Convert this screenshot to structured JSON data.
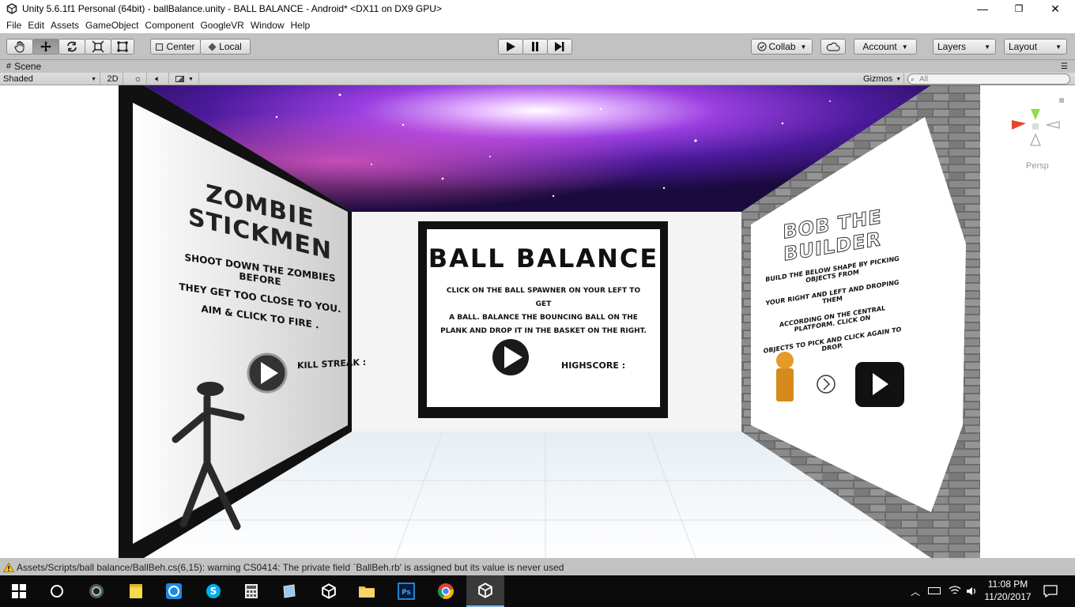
{
  "window": {
    "title": "Unity 5.6.1f1 Personal (64bit) - ballBalance.unity - BALL BALANCE - Android* <DX11 on DX9 GPU>",
    "controls": [
      "—",
      "❐",
      "✕"
    ]
  },
  "menu": [
    "File",
    "Edit",
    "Assets",
    "GameObject",
    "Component",
    "GoogleVR",
    "Window",
    "Help"
  ],
  "toolbar": {
    "pivot_label": "Center",
    "space_label": "Local",
    "collab_label": "Collab",
    "account_label": "Account",
    "layers_label": "Layers",
    "layout_label": "Layout"
  },
  "scene": {
    "tab_label": "Scene",
    "shading_mode": "Shaded",
    "mode_2d": "2D",
    "gizmos_label": "Gizmos",
    "search_placeholder": "All",
    "projection_label": "Persp"
  },
  "boards": {
    "left": {
      "title": "ZOMBIE STICKMEN",
      "text": [
        "SHOOT DOWN THE ZOMBIES BEFORE",
        "THEY GET TOO CLOSE TO YOU.",
        "AIM & CLICK TO FIRE ."
      ],
      "kill_streak": "KILL STREAK :"
    },
    "center": {
      "title": "BALL BALANCE",
      "text": [
        "CLICK ON THE BALL SPAWNER ON YOUR LEFT TO GET",
        "A BALL. BALANCE THE BOUNCING BALL ON THE",
        "PLANK AND DROP IT IN THE BASKET ON THE RIGHT."
      ],
      "highscore": "HIGHSCORE :"
    },
    "right": {
      "title": "BOB THE BUILDER",
      "text": [
        "BUILD THE BELOW SHAPE BY PICKING OBJECTS FROM",
        "YOUR RIGHT AND LEFT AND DROPING THEM",
        "ACCORDING ON THE CENTRAL PLATFORM. CLICK ON",
        "OBJECTS TO PICK AND CLICK AGAIN TO DROP."
      ]
    }
  },
  "status": {
    "message": "Assets/Scripts/ball balance/BallBeh.cs(6,15): warning CS0414: The private field `BallBeh.rb' is assigned but its value is never used"
  },
  "taskbar": {
    "time": "11:08 PM",
    "date": "11/20/2017"
  },
  "colors": {
    "editor_bg": "#c2c2c2",
    "warning": "#f5c518",
    "nebula": "#7a2fd6",
    "taskbar": "#0b0b0b"
  }
}
